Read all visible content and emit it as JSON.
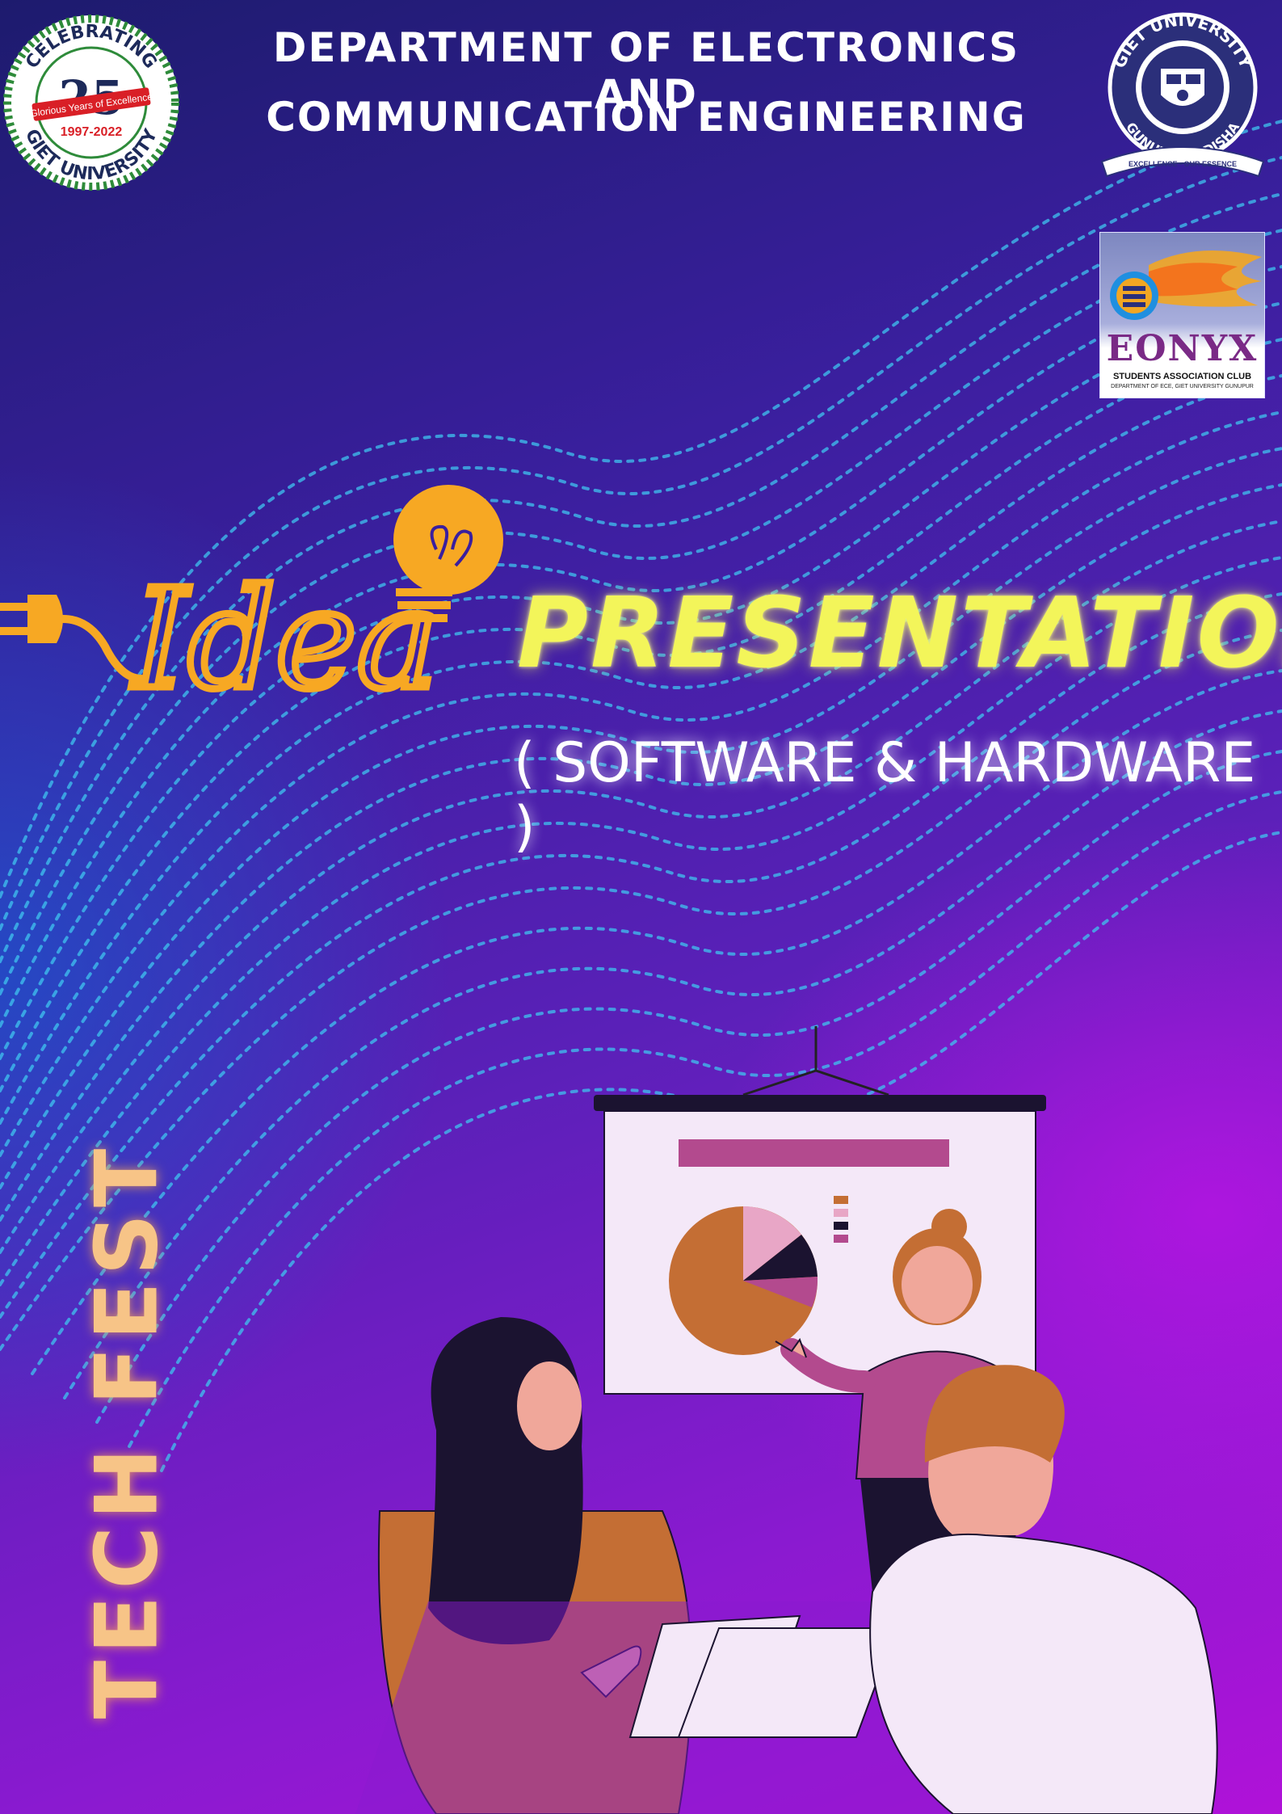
{
  "header": {
    "line1": "DEPARTMENT OF ELECTRONICS AND",
    "line2": "COMMUNICATION ENGINEERING"
  },
  "badge_left": {
    "top_text": "CELEBRATING",
    "number": "25",
    "ribbon": "Glorious Years of Excellence",
    "years": "1997-2022",
    "bottom_text": "GIET UNIVERSITY"
  },
  "badge_right": {
    "top_text": "GIET UNIVERSITY",
    "bottom_text": "GUNUPUR, ODISHA",
    "motto": "EXCELLENCE - OUR ESSENCE"
  },
  "eonyx": {
    "name": "EONYX",
    "club": "STUDENTS ASSOCIATION CLUB",
    "dept": "DEPARTMENT OF ECE, GIET UNIVERSITY GUNUPUR"
  },
  "idea_word": "Idea",
  "title": "PRESENTATION",
  "subtitle": "( SOFTWARE & HARDWARE )",
  "vertical_label": "TECH FEST",
  "colors": {
    "title_yellow": "#f3f55a",
    "bulb_orange": "#f7a823",
    "dots_cyan": "#3fc4f0",
    "vertical_text": "#f7c487"
  }
}
